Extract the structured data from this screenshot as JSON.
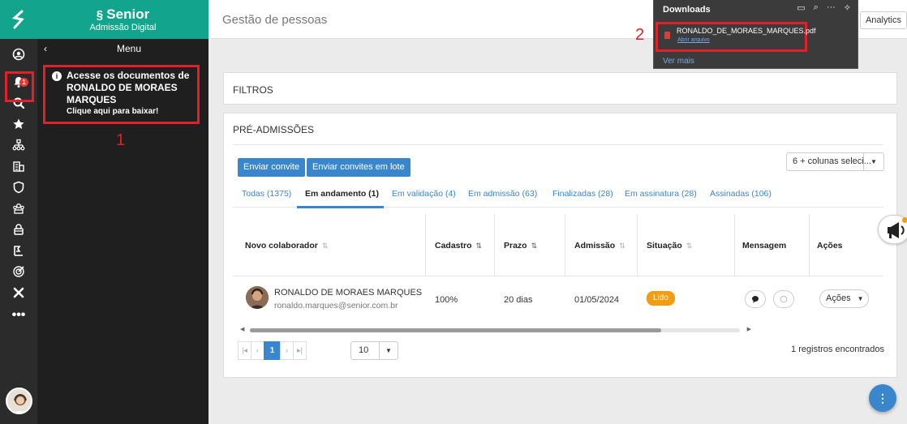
{
  "rail": {
    "logo_glyph": "S",
    "items": [
      "user-circle-icon",
      "bell-icon",
      "search-icon",
      "star-icon",
      "org-chart-icon",
      "building-icon",
      "shield-icon",
      "people-icon",
      "lock-icon",
      "badge-icon",
      "target-icon",
      "x-icon",
      "more-icon"
    ],
    "bell_badge": "1"
  },
  "menu": {
    "brand": "Senior",
    "subtitle": "Admissão Digital",
    "title": "Menu",
    "notice_line1": "Acesse os documentos de",
    "notice_name": "RONALDO DE MORAES MARQUES",
    "notice_link": "Clique aqui para baixar!",
    "step_label": "1"
  },
  "header": {
    "title": "Gestão de pessoas",
    "analytics_label": "Analytics"
  },
  "downloads": {
    "title": "Downloads",
    "file_name": "RONALDO_DE_MORAES_MARQUES.pdf",
    "open_label": "Abrir arquivo",
    "more_label": "Ver mais",
    "step_label": "2"
  },
  "filters": {
    "label": "FILTROS"
  },
  "pre_admissions": {
    "title": "PRÉ-ADMISSÕES",
    "send_invite": "Enviar convite",
    "send_batch": "Enviar convites em lote",
    "columns_select": "6 + colunas seleci...",
    "tabs": [
      "Todas (1375)",
      "Em andamento (1)",
      "Em validação (4)",
      "Em admissão (63)",
      "Finalizadas (28)",
      "Em assinatura (28)",
      "Assinadas (106)"
    ],
    "columns": [
      "Novo colaborador",
      "Cadastro",
      "Prazo",
      "Admissão",
      "Situação",
      "Mensagem",
      "Ações"
    ],
    "row": {
      "name": "RONALDO DE MORAES MARQUES",
      "email": "ronaldo.marques@senior.com.br",
      "cadastro": "100%",
      "prazo": "20 dias",
      "admissao": "01/05/2024",
      "situacao": "Lido",
      "acoes": "Ações"
    },
    "pagination": {
      "current_page": "1",
      "page_size": "10",
      "records": "1 registros encontrados"
    }
  },
  "fab_label": "⋮",
  "accent": "#3a86cc",
  "brand_color": "#12a48c",
  "highlight": "#e0202a"
}
